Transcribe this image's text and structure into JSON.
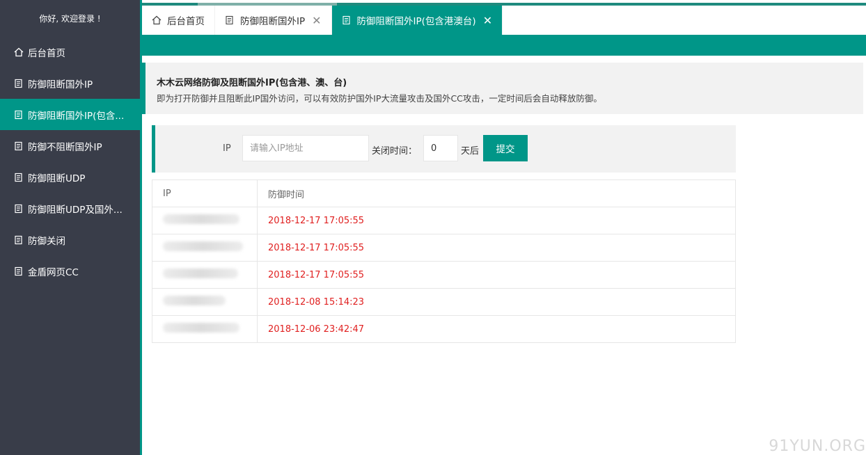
{
  "sidebar": {
    "greeting": "你好, 欢迎登录 !",
    "items": [
      {
        "label": "后台首页",
        "icon": "home-icon"
      },
      {
        "label": "防御阻断国外IP",
        "icon": "document-icon"
      },
      {
        "label": "防御阻断国外IP(包含...",
        "icon": "document-icon"
      },
      {
        "label": "防御不阻断国外IP",
        "icon": "document-icon"
      },
      {
        "label": "防御阻断UDP",
        "icon": "document-icon"
      },
      {
        "label": "防御阻断UDP及国外...",
        "icon": "document-icon"
      },
      {
        "label": "防御关闭",
        "icon": "document-icon"
      },
      {
        "label": "金盾网页CC",
        "icon": "document-icon"
      }
    ],
    "active_index": 2
  },
  "tabs": [
    {
      "label": "后台首页"
    },
    {
      "label": "防御阻断国外IP"
    },
    {
      "label": "防御阻断国外IP(包含港澳台)"
    }
  ],
  "notice": {
    "title": "木木云网络防御及阻断国外IP(包含港、澳、台)",
    "desc": "即为打开防御并且阻断此IP国外访问，可以有效防护国外IP大流量攻击及国外CC攻击，一定时间后会自动释放防御。"
  },
  "form": {
    "ip_label": "IP",
    "ip_placeholder": "请输入IP地址",
    "close_label": "关闭时间：",
    "days_value": "0",
    "days_unit": "天后",
    "submit_label": "提交"
  },
  "table": {
    "headers": [
      "IP",
      "防御时间"
    ],
    "rows": [
      {
        "time": "2018-12-17 17:05:55"
      },
      {
        "time": "2018-12-17 17:05:55"
      },
      {
        "time": "2018-12-17 17:05:55"
      },
      {
        "time": "2018-12-08 15:14:23"
      },
      {
        "time": "2018-12-06 23:42:47"
      }
    ]
  },
  "watermark": "91YUN.ORG",
  "colors": {
    "accent": "#009688",
    "sidebar_bg": "#393d49",
    "time_red": "#e02020"
  }
}
